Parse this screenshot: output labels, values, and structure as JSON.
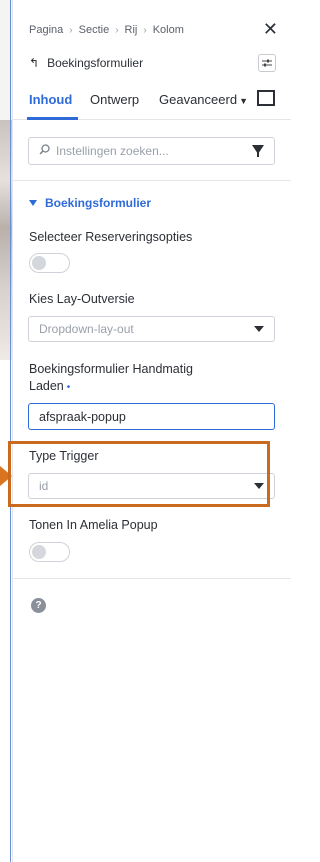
{
  "breadcrumb": [
    "Pagina",
    "Sectie",
    "Rij",
    "Kolom"
  ],
  "breadcrumb_separator": "›",
  "close_glyph": "✕",
  "title": "Boekingsformulier",
  "back_icon_glyph": "↰",
  "tabs": [
    {
      "label": "Inhoud",
      "active": true
    },
    {
      "label": "Ontwerp",
      "active": false
    },
    {
      "label": "Geavanceerd",
      "active": false
    }
  ],
  "search": {
    "placeholder": "Instellingen zoeken...",
    "icon": "search-icon"
  },
  "section": {
    "title": "Boekingsformulier"
  },
  "fields": {
    "reservation_options": {
      "label": "Selecteer Reserveringsopties",
      "enabled": false
    },
    "layout_version": {
      "label": "Kies Lay-Outversie",
      "value": "Dropdown-lay-out"
    },
    "manual_load": {
      "label_line1": "Boekingsformulier Handmatig",
      "label_line2": "Laden",
      "required_dot": "•",
      "value": "afspraak-popup"
    },
    "trigger_type": {
      "label": "Type Trigger",
      "value": "id"
    },
    "amelia_popup": {
      "label": "Tonen In Amelia Popup",
      "enabled": false
    }
  },
  "help_glyph": "?",
  "colors": {
    "accent": "#2f6bd8",
    "highlight": "#c96a1e"
  }
}
